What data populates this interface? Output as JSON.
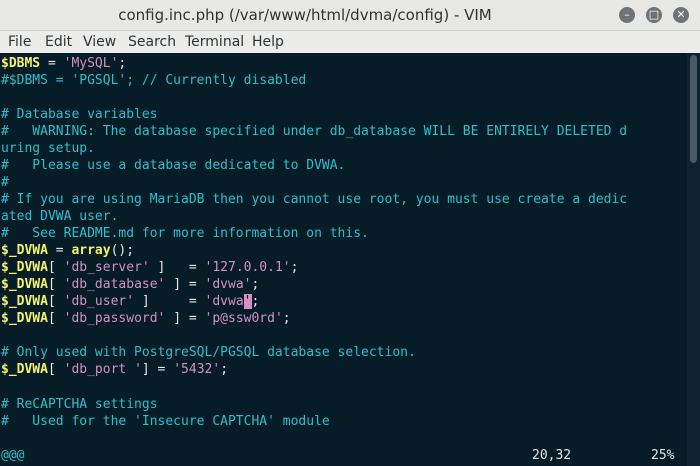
{
  "window": {
    "title": "config.inc.php (/var/www/html/dvma/config) - VIM",
    "minimize_glyph": "–",
    "maximize_glyph": "□",
    "close_glyph": "✕"
  },
  "menu": {
    "file": "File",
    "edit": "Edit",
    "view": "View",
    "search": "Search",
    "terminal": "Terminal",
    "help": "Help"
  },
  "code": {
    "l1": {
      "var": "$DBMS",
      "op": " = ",
      "str": "'MySQL'",
      "end": ";"
    },
    "l2": {
      "text": "#$DBMS = 'PGSQL'; // Currently disabled"
    },
    "l4": {
      "text": "# Database variables"
    },
    "l5": {
      "text": "#   WARNING: The database specified under db_database WILL BE ENTIRELY DELETED d"
    },
    "l6": {
      "text": "uring setup."
    },
    "l7": {
      "text": "#   Please use a database dedicated to DVWA."
    },
    "l8": {
      "text": "#"
    },
    "l9": {
      "text": "# If you are using MariaDB then you cannot use root, you must use create a dedic"
    },
    "l10": {
      "text": "ated DVWA user."
    },
    "l11": {
      "text": "#   See README.md for more information on this."
    },
    "l12": {
      "var": "$_DVWA",
      "op": " = ",
      "fn": "array",
      "end": "();"
    },
    "l13": {
      "var": "$_DVWA",
      "b1": "[ ",
      "key": "'db_server'",
      "b2": " ]   = ",
      "str": "'127.0.0.1'",
      "end": ";"
    },
    "l14": {
      "var": "$_DVWA",
      "b1": "[ ",
      "key": "'db_database'",
      "b2": " ] = ",
      "str": "'dvwa'",
      "end": ";"
    },
    "l15": {
      "var": "$_DVWA",
      "b1": "[ ",
      "key": "'db_user'",
      "b2": " ]     = ",
      "str": "'dvwa",
      "cur": "'",
      "end": ";"
    },
    "l16": {
      "var": "$_DVWA",
      "b1": "[ ",
      "key": "'db_password'",
      "b2": " ] = ",
      "str": "'p@ssw0rd'",
      "end": ";"
    },
    "l18": {
      "text": "# Only used with PostgreSQL/PGSQL database selection."
    },
    "l19": {
      "var": "$_DVWA",
      "b1": "[ ",
      "key": "'db_port '",
      "b2": "] = ",
      "str": "'5432'",
      "end": ";"
    },
    "l21": {
      "text": "# ReCAPTCHA settings"
    },
    "l22": {
      "text": "#   Used for the 'Insecure CAPTCHA' module"
    }
  },
  "status": {
    "continuation": "@@@",
    "position": "20,32",
    "percent": "25%"
  },
  "colors": {
    "background": "#061c26",
    "comment": "#2cc0cc",
    "variable": "#f6f36f",
    "string": "#d58fc6"
  }
}
